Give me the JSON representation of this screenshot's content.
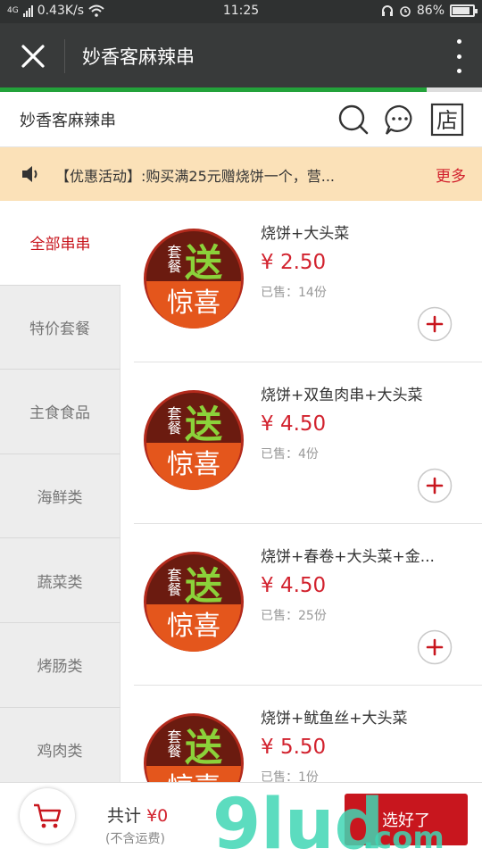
{
  "status": {
    "network": "4G",
    "speed": "0.43K/s",
    "time": "11:25",
    "battery": "86%",
    "battery_level": 0.86
  },
  "titlebar": {
    "title": "妙香客麻辣串"
  },
  "page_load_progress": 0.885,
  "shop": {
    "name": "妙香客麻辣串",
    "store_icon_char": "店"
  },
  "notice": {
    "text": "【优惠活动】:购买满25元赠烧饼一个，营...",
    "more": "更多"
  },
  "categories": [
    {
      "label": "全部串串",
      "active": true
    },
    {
      "label": "特价套餐",
      "active": false
    },
    {
      "label": "主食食品",
      "active": false
    },
    {
      "label": "海鲜类",
      "active": false
    },
    {
      "label": "蔬菜类",
      "active": false
    },
    {
      "label": "烤肠类",
      "active": false
    },
    {
      "label": "鸡肉类",
      "active": false
    }
  ],
  "badge": {
    "line1": "套餐",
    "big": "送",
    "bottom": "惊喜"
  },
  "products": [
    {
      "name": "烧饼+大头菜",
      "price": "¥ 2.50",
      "sold": "已售：14份"
    },
    {
      "name": "烧饼+双鱼肉串+大头菜",
      "price": "¥ 4.50",
      "sold": "已售：4份"
    },
    {
      "name": "烧饼+春卷+大头菜+金...",
      "price": "¥ 4.50",
      "sold": "已售：25份"
    },
    {
      "name": "烧饼+鱿鱼丝+大头菜",
      "price": "¥ 5.50",
      "sold": "已售：1份"
    }
  ],
  "cart": {
    "total_label": "共计",
    "total_amount": "¥0",
    "shipping_note": "(不含运费)",
    "submit": "选好了"
  },
  "watermark": {
    "brand": "9lud",
    "suffix": ".com"
  },
  "colors": {
    "accent_red": "#c8161e",
    "price_red": "#d2222e",
    "notice_bg": "#fbe1b8",
    "progress_green": "#23a23a",
    "titlebar_bg": "#383a3a"
  }
}
